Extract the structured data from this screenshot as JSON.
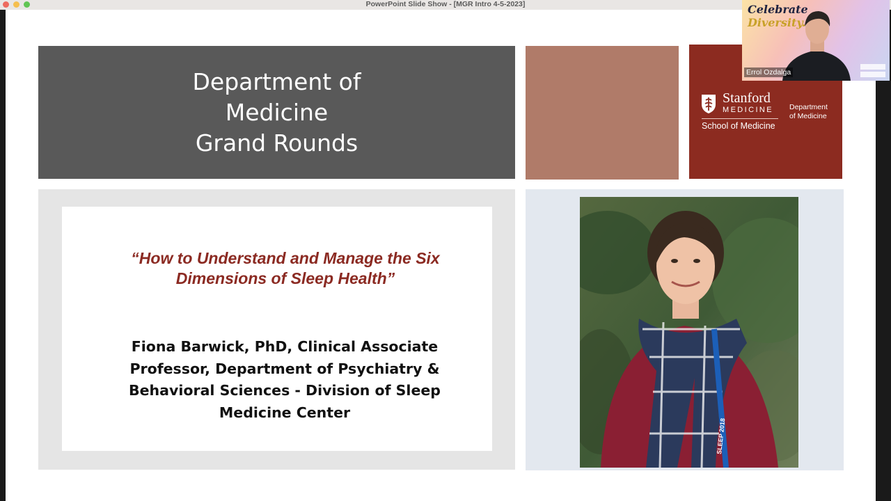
{
  "window": {
    "title": "PowerPoint Slide Show - [MGR Intro 4-5-2023]"
  },
  "slide": {
    "title": "Department of\nMedicine\nGrand Rounds",
    "logo": {
      "wordmark_top": "Stanford",
      "wordmark_bottom": "MEDICINE",
      "school": "School of Medicine",
      "department": "Department\nof Medicine"
    },
    "talk_title": "“How to Understand and Manage the Six\nDimensions of Sleep Health”",
    "speaker": "Fiona Barwick, PhD, Clinical Associate\nProfessor, Department of Psychiatry &\nBehavioral Sciences - Division of Sleep\nMedicine Center",
    "lanyard_text": "SLEEP 2018",
    "colors": {
      "title_box": "#595959",
      "tan_box": "#b07b69",
      "stanford_red": "#8c2b20",
      "talk_title": "#8b2a22"
    }
  },
  "webcam": {
    "banner_line1": "Celebrate",
    "banner_line2": "Diversity.",
    "participant_name": "Errol Ozdalga"
  }
}
